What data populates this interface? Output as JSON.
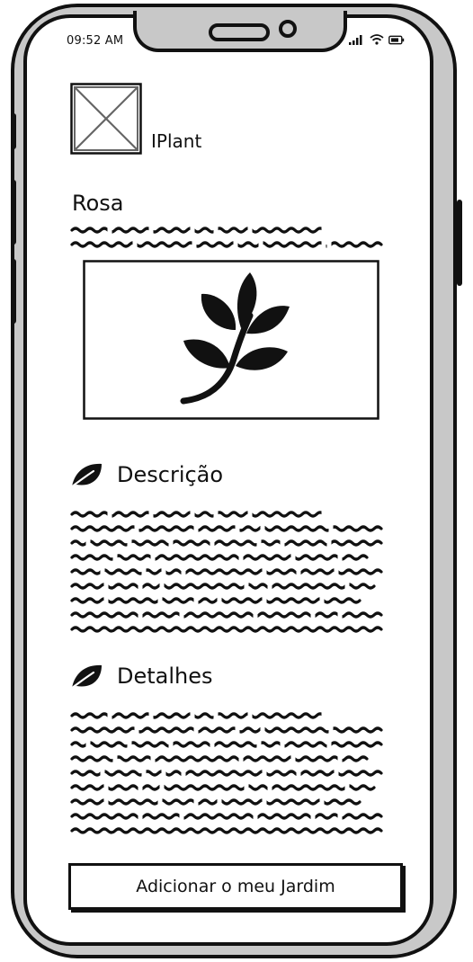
{
  "status_bar": {
    "time": "09:52 AM"
  },
  "header": {
    "app_name": "IPlant",
    "logo_icon": "image-placeholder-icon"
  },
  "plant": {
    "name": "Rosa",
    "image_icon": "leaf-branch-icon"
  },
  "sections": [
    {
      "title": "Descrição",
      "icon": "leaf-icon"
    },
    {
      "title": "Detalhes",
      "icon": "leaf-icon"
    }
  ],
  "actions": {
    "add_to_garden_label": "Adicionar o meu Jardim"
  },
  "colors": {
    "frame": "#c8c8c8",
    "ink": "#111111",
    "screen": "#ffffff"
  }
}
